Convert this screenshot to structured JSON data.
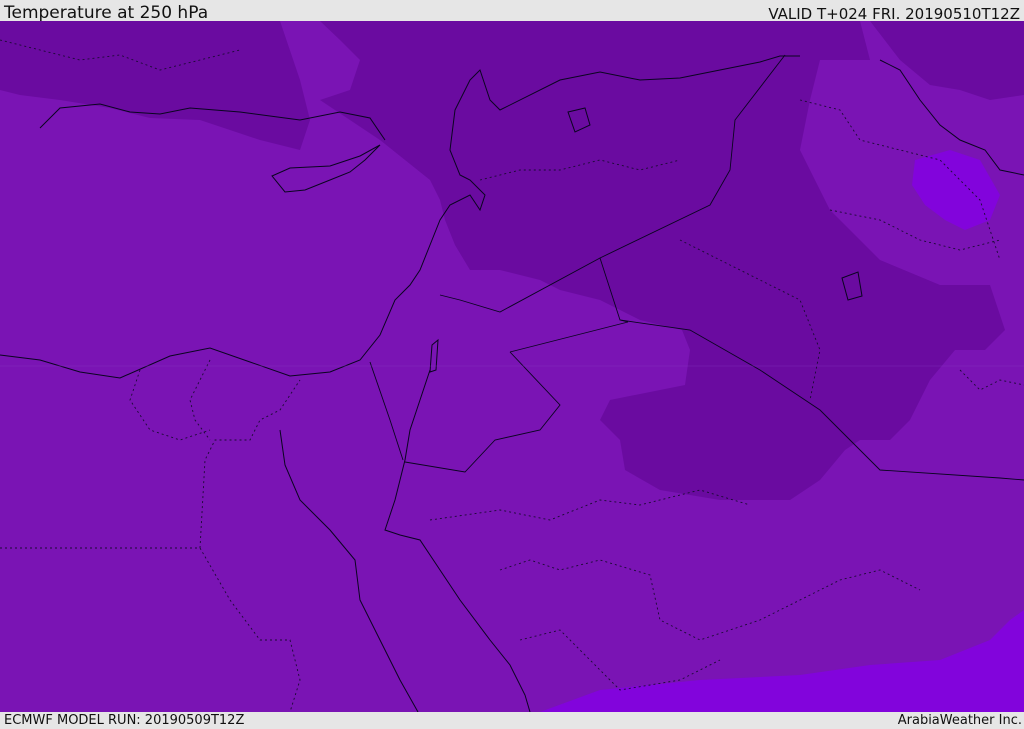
{
  "header": {
    "title": "Temperature at 250 hPa",
    "valid": "VALID T+024 FRI. 20190510T12Z"
  },
  "footer": {
    "model_run": "ECMWF MODEL RUN: 20190509T12Z",
    "credit": "ArabiaWeather Inc."
  },
  "colors": {
    "base": "#7a14b4",
    "cold": "#6a0ba0",
    "warm": "#8204dc",
    "bar": "#e6e6e6"
  }
}
